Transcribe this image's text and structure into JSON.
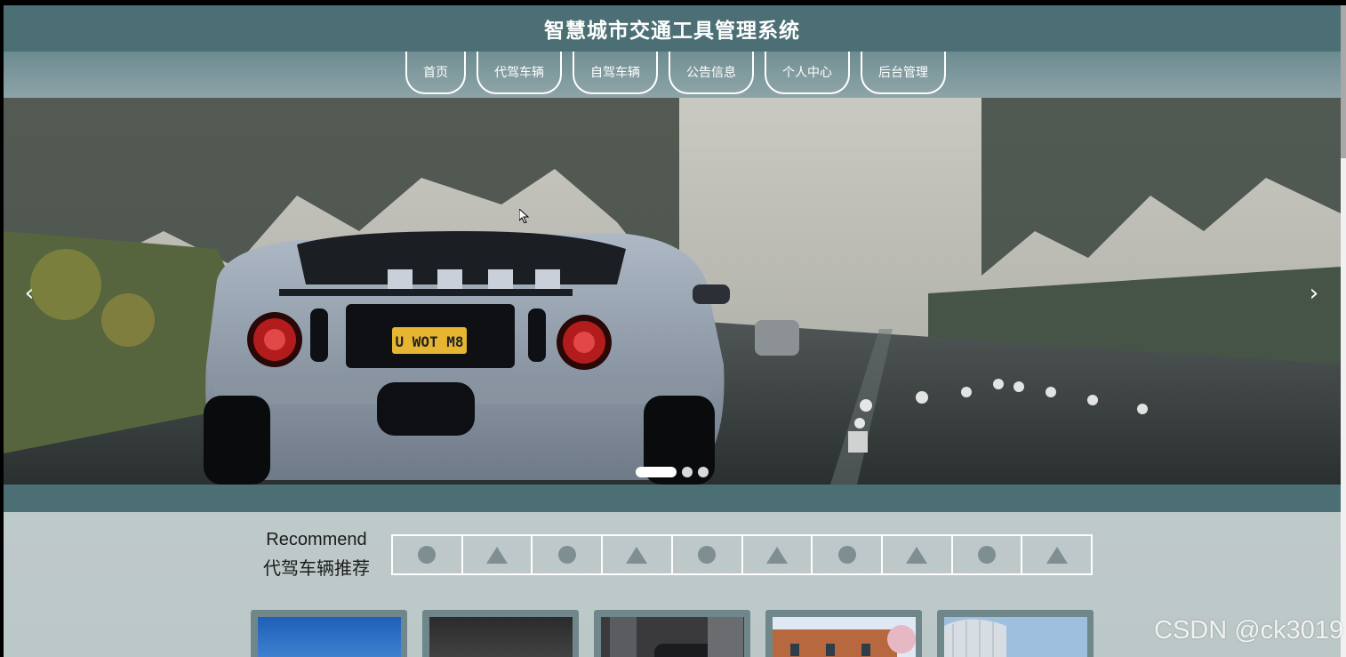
{
  "header": {
    "title": "智慧城市交通工具管理系统"
  },
  "nav": {
    "items": [
      {
        "label": "首页"
      },
      {
        "label": "代驾车辆"
      },
      {
        "label": "自驾车辆"
      },
      {
        "label": "公告信息"
      },
      {
        "label": "个人中心"
      },
      {
        "label": "后台管理"
      }
    ]
  },
  "carousel": {
    "prev_icon": "chevron-left-icon",
    "next_icon": "chevron-right-icon",
    "prev_glyph": "‹",
    "next_glyph": "›",
    "slide_count": 3,
    "active_index": 0,
    "plate_text": "U WOT M8"
  },
  "recommend": {
    "en_title": "Recommend",
    "cn_title": "代驾车辆推荐",
    "shapes": [
      "circle",
      "triangle",
      "circle",
      "triangle",
      "circle",
      "triangle",
      "circle",
      "triangle",
      "circle",
      "triangle"
    ]
  },
  "cards": [
    {
      "name": "car-card-1"
    },
    {
      "name": "car-card-2"
    },
    {
      "name": "car-card-3"
    },
    {
      "name": "car-card-4"
    },
    {
      "name": "car-card-5"
    }
  ],
  "watermark": "CSDN @ck3019",
  "colors": {
    "header_bg": "#4b6f75",
    "nav_bg": "#7d979b",
    "shape_fill": "#7f8f91"
  }
}
